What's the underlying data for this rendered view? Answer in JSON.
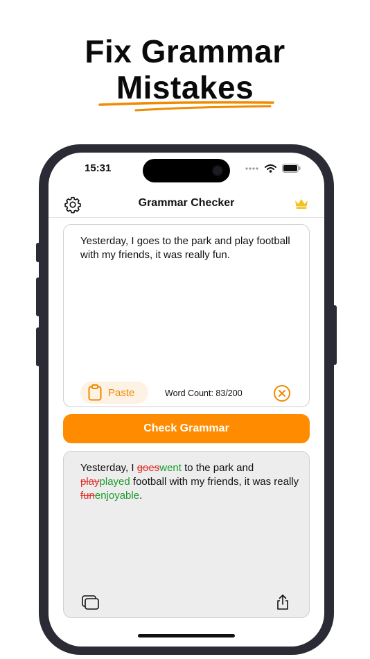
{
  "headline": {
    "line1": "Fix Grammar",
    "line2": "Mistakes",
    "underline_color": "#f08a00"
  },
  "status_bar": {
    "time": "15:31",
    "icons": [
      "signal-dots-icon",
      "wifi-icon",
      "battery-icon"
    ]
  },
  "nav": {
    "title": "Grammar Checker",
    "left_icon": "gear-icon",
    "right_icon": "crown-icon",
    "crown_color": "#f2c21b"
  },
  "input": {
    "text": "Yesterday, I goes to the park and play football with my friends, it was really fun.",
    "paste_label": "Paste",
    "word_count": "Word Count: 83/200"
  },
  "check_button": {
    "label": "Check Grammar",
    "color": "#ff8c00"
  },
  "result": {
    "segments": [
      {
        "type": "plain",
        "text": "Yesterday, I "
      },
      {
        "type": "del",
        "text": "goes"
      },
      {
        "type": "ins",
        "text": "went"
      },
      {
        "type": "plain",
        "text": " to the park and "
      },
      {
        "type": "del",
        "text": "play"
      },
      {
        "type": "ins",
        "text": "played"
      },
      {
        "type": "plain",
        "text": " football with my friends, it was really "
      },
      {
        "type": "del",
        "text": "fun"
      },
      {
        "type": "ins",
        "text": "enjoyable"
      },
      {
        "type": "plain",
        "text": "."
      }
    ],
    "del_color": "#e0312a",
    "ins_color": "#1c9a30"
  }
}
